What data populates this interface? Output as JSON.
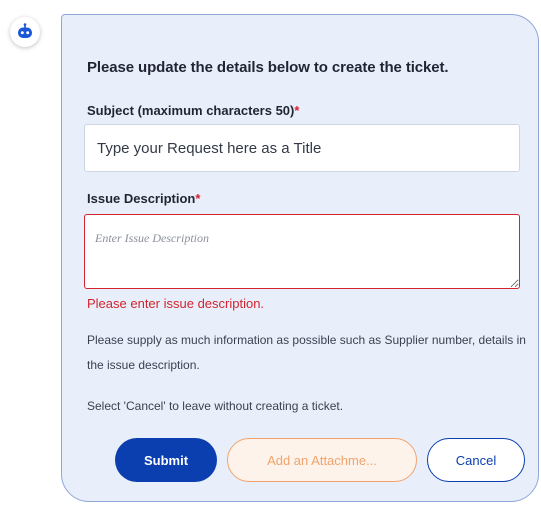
{
  "form": {
    "intro": "Please update the details below to create the ticket.",
    "subject_label": "Subject (maximum characters 50)",
    "subject_placeholder": "Type your Request here as a Title",
    "description_label": "Issue Description",
    "description_placeholder": "Enter Issue Description",
    "required_mark": "*",
    "error_message": "Please enter issue description.",
    "help_text": "Please supply as much information as possible such as Supplier number, details in the issue description.",
    "cancel_note": "Select 'Cancel' to leave without creating a ticket."
  },
  "buttons": {
    "submit": "Submit",
    "attach": "Add an Attachme...",
    "cancel": "Cancel"
  },
  "icons": {
    "avatar": "chatbot-icon"
  },
  "colors": {
    "card_background": "#e9effa",
    "card_border": "#8ea6d8",
    "primary": "#0b3fb0",
    "error": "#d2242f",
    "attach_accent": "#f2a36c"
  }
}
